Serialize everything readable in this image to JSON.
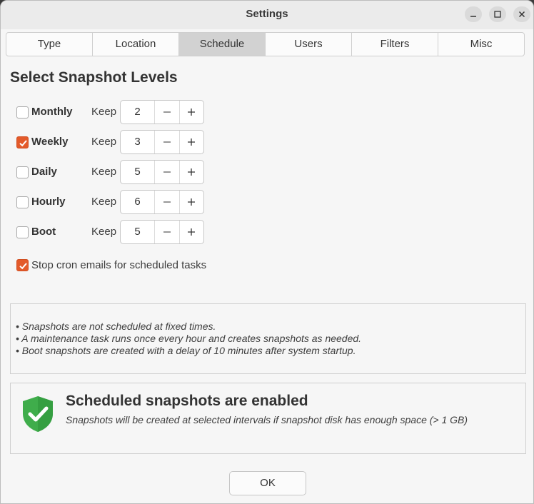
{
  "window": {
    "title": "Settings",
    "controls": [
      "minimize-icon",
      "maximize-icon",
      "close-icon"
    ]
  },
  "tabs": [
    {
      "label": "Type",
      "active": false
    },
    {
      "label": "Location",
      "active": false
    },
    {
      "label": "Schedule",
      "active": true
    },
    {
      "label": "Users",
      "active": false
    },
    {
      "label": "Filters",
      "active": false
    },
    {
      "label": "Misc",
      "active": false
    }
  ],
  "schedule": {
    "title": "Select Snapshot Levels",
    "keep_label": "Keep",
    "levels": [
      {
        "label": "Monthly",
        "checked": false,
        "keep": "2"
      },
      {
        "label": "Weekly",
        "checked": true,
        "keep": "3"
      },
      {
        "label": "Daily",
        "checked": false,
        "keep": "5"
      },
      {
        "label": "Hourly",
        "checked": false,
        "keep": "6"
      },
      {
        "label": "Boot",
        "checked": false,
        "keep": "5"
      }
    ],
    "stop_cron": {
      "label": "Stop cron emails for scheduled tasks",
      "checked": true
    }
  },
  "notes": [
    "• Snapshots are not scheduled at fixed times.",
    "• A maintenance task runs once every hour and creates snapshots as needed.",
    "• Boot snapshots are created with a delay of 10 minutes after system startup."
  ],
  "status": {
    "icon": "shield-check-icon",
    "title": "Scheduled snapshots are enabled",
    "message": "Snapshots will be created at selected intervals if snapshot disk has enough space (> 1 GB)"
  },
  "ok_label": "OK",
  "colors": {
    "accent": "#e35a2a",
    "shield": "#3fad4b"
  }
}
